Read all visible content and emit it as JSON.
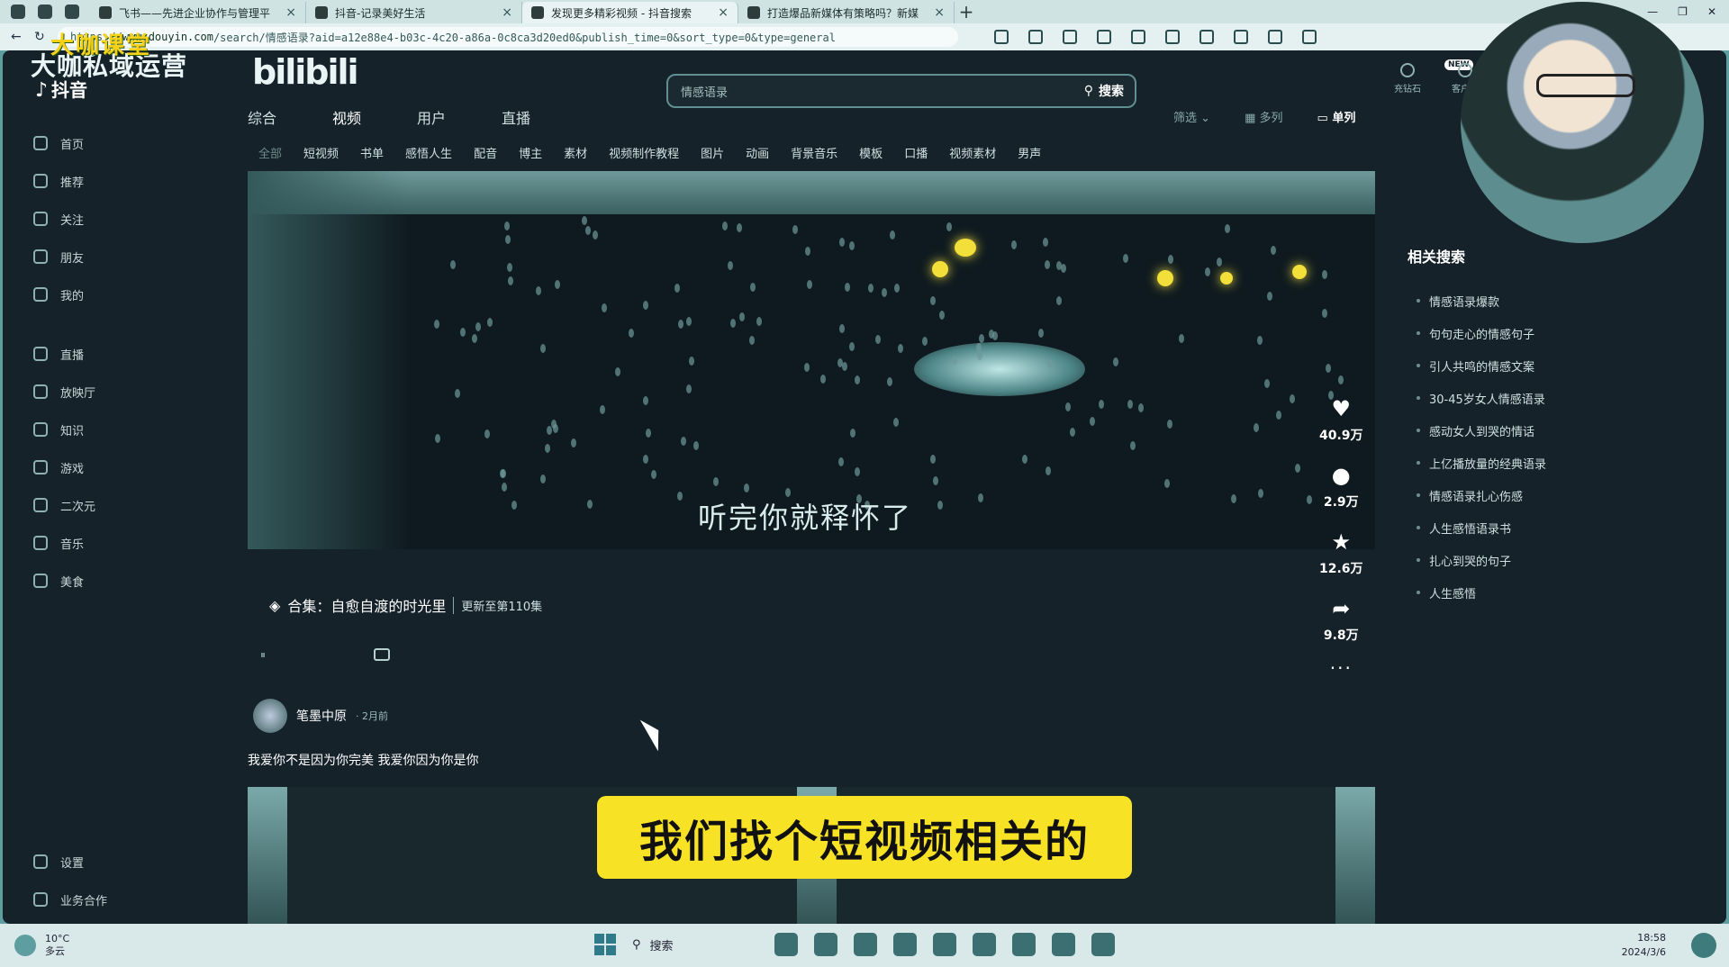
{
  "browser": {
    "tabs": [
      {
        "title": "飞书——先进企业协作与管理平",
        "active": false
      },
      {
        "title": "抖音-记录美好生活",
        "active": false
      },
      {
        "title": "发现更多精彩视频 - 抖音搜索",
        "active": true
      },
      {
        "title": "打造爆品新媒体有策略吗？新媒",
        "active": false
      }
    ],
    "url_prefix": "https://",
    "url_host": "www.douyin.com",
    "url_path": "/search/情感语录?aid=a12e88e4-b03c-4c20-a86a-0c8ca3d20ed0&publish_time=0&sort_type=0&type=general"
  },
  "watermark": {
    "course": "大咖课堂",
    "brand": "大咖私域运营",
    "bili": "bilibili"
  },
  "app": {
    "logo": "抖音",
    "search_query": "情感语录",
    "search_button": "搜索",
    "top_right": [
      "充钻石",
      "客户端"
    ],
    "new_badge": "NEW"
  },
  "sidebar": {
    "items": [
      "首页",
      "推荐",
      "关注",
      "朋友",
      "我的"
    ],
    "items2": [
      "直播",
      "放映厅",
      "知识",
      "游戏",
      "二次元",
      "音乐",
      "美食"
    ],
    "bottom": [
      "设置",
      "业务合作"
    ]
  },
  "main_tabs": [
    "综合",
    "视频",
    "用户",
    "直播"
  ],
  "view_controls": {
    "filter": "筛选",
    "multi": "多列",
    "single": "单列"
  },
  "sub_tabs": [
    "全部",
    "短视频",
    "书单",
    "感悟人生",
    "配音",
    "博主",
    "素材",
    "视频制作教程",
    "图片",
    "动画",
    "背景音乐",
    "模板",
    "口播",
    "视频素材",
    "男声"
  ],
  "video": {
    "caption": "听完你就释怀了",
    "likes": "40.9万",
    "comments": "2.9万",
    "favorites": "12.6万",
    "shares": "9.8万",
    "collection_label": "合集：自愈自渡的时光里",
    "collection_update": "更新至第110集",
    "author": "笔墨中原",
    "time": "2月前",
    "description": "我爱你不是因为你完美 我爱你因为你是你"
  },
  "related": {
    "title": "相关搜索",
    "items": [
      "情感语录爆款",
      "句句走心的情感句子",
      "引人共鸣的情感文案",
      "30-45岁女人情感语录",
      "感动女人到哭的情话",
      "上亿播放量的经典语录",
      "情感语录扎心伤感",
      "人生感悟语录书",
      "扎心到哭的句子",
      "人生感悟"
    ]
  },
  "subtitle_overlay": "我们找个短视频相关的",
  "taskbar": {
    "temp": "10°C",
    "weather": "多云",
    "search": "搜索",
    "time": "18:58",
    "date": "2024/3/6"
  },
  "colors": {
    "accent_yellow": "#f7e226",
    "app_bg": "#16222a"
  }
}
